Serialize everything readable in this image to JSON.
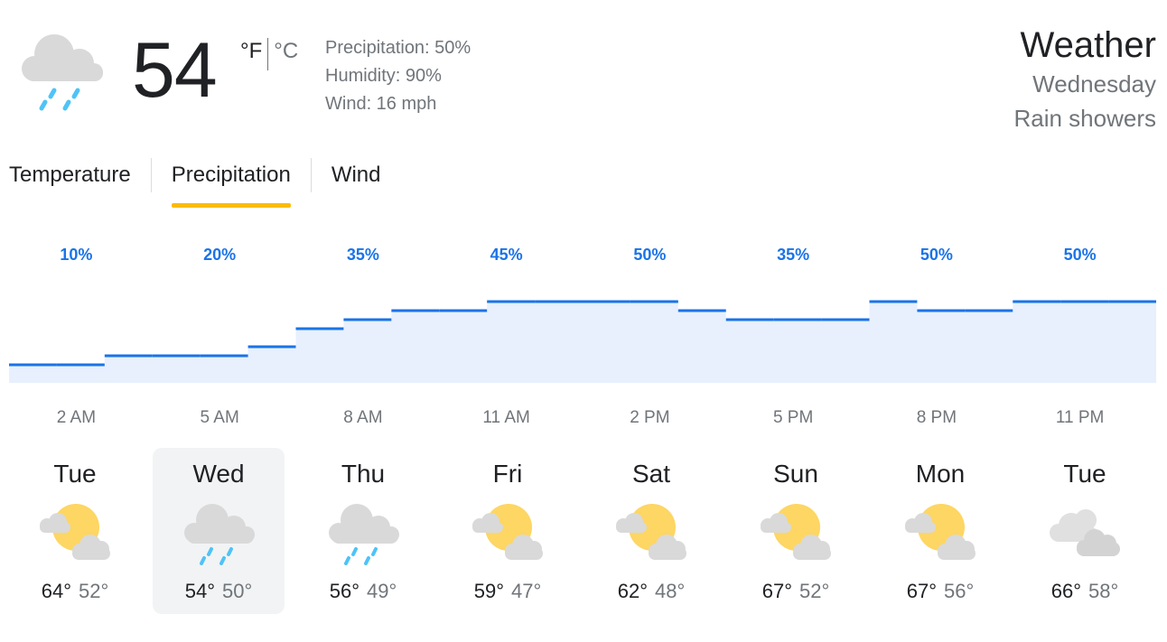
{
  "current": {
    "icon": "rain-showers-icon",
    "temp": "54",
    "unit_f": "°F",
    "unit_c": "°C",
    "precipitation": "Precipitation: 50%",
    "humidity": "Humidity: 90%",
    "wind": "Wind: 16 mph"
  },
  "header": {
    "title": "Weather",
    "day": "Wednesday",
    "condition": "Rain showers"
  },
  "tabs": [
    {
      "label": "Temperature",
      "active": false
    },
    {
      "label": "Precipitation",
      "active": true
    },
    {
      "label": "Wind",
      "active": false
    }
  ],
  "colors": {
    "accent_tab": "#fbbc04",
    "precip_line": "#1a73e8",
    "precip_fill": "#e8f0fe",
    "precip_label": "#1a73e8",
    "muted_text": "#70757a"
  },
  "chart_data": {
    "type": "area",
    "step": true,
    "unit": "%",
    "ylim": [
      0,
      100
    ],
    "labels": [
      "10%",
      "20%",
      "35%",
      "45%",
      "50%",
      "35%",
      "50%",
      "50%"
    ],
    "times": [
      "2 AM",
      "5 AM",
      "8 AM",
      "11 AM",
      "2 PM",
      "5 PM",
      "8 PM",
      "11 PM"
    ],
    "hourly_values": [
      10,
      10,
      15,
      15,
      15,
      20,
      30,
      35,
      40,
      40,
      45,
      45,
      45,
      45,
      40,
      35,
      35,
      35,
      45,
      40,
      40,
      45,
      45,
      45
    ]
  },
  "forecast": [
    {
      "day": "Tue",
      "icon": "partly-cloudy-icon",
      "hi": "64°",
      "lo": "52°",
      "selected": false
    },
    {
      "day": "Wed",
      "icon": "rain-showers-icon",
      "hi": "54°",
      "lo": "50°",
      "selected": true
    },
    {
      "day": "Thu",
      "icon": "rain-showers-icon",
      "hi": "56°",
      "lo": "49°",
      "selected": false
    },
    {
      "day": "Fri",
      "icon": "partly-cloudy-icon",
      "hi": "59°",
      "lo": "47°",
      "selected": false
    },
    {
      "day": "Sat",
      "icon": "partly-cloudy-icon",
      "hi": "62°",
      "lo": "48°",
      "selected": false
    },
    {
      "day": "Sun",
      "icon": "partly-cloudy-icon",
      "hi": "67°",
      "lo": "52°",
      "selected": false
    },
    {
      "day": "Mon",
      "icon": "partly-cloudy-icon",
      "hi": "67°",
      "lo": "56°",
      "selected": false
    },
    {
      "day": "Tue",
      "icon": "cloudy-icon",
      "hi": "66°",
      "lo": "58°",
      "selected": false
    }
  ]
}
